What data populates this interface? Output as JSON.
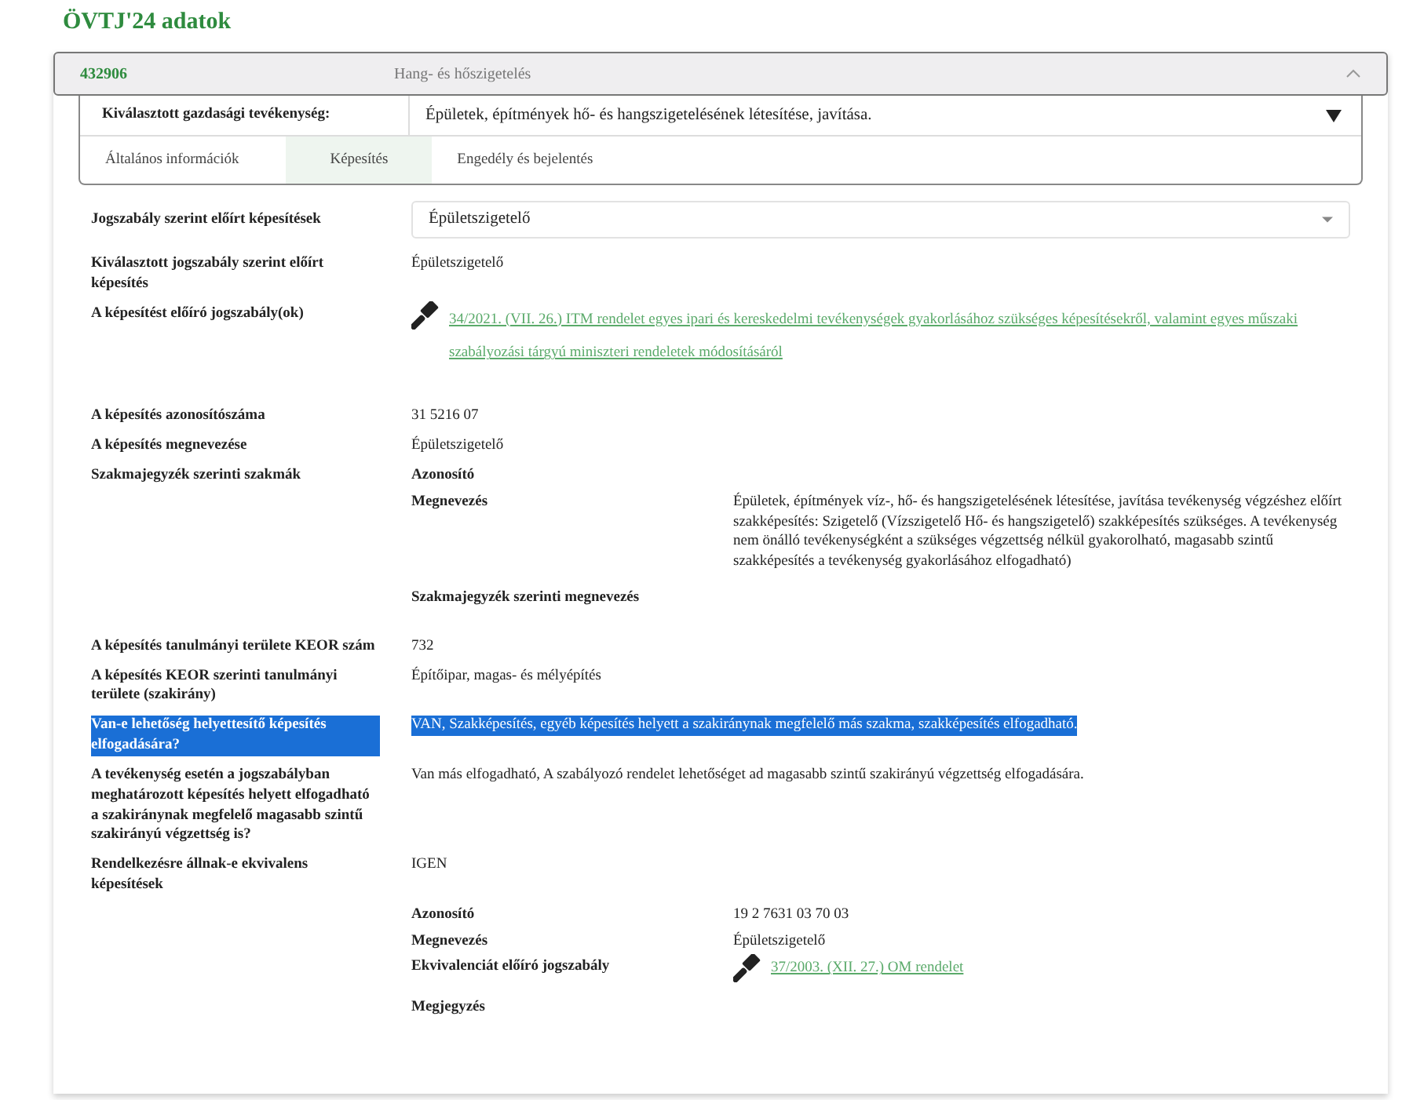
{
  "title": "ÖVTJ'24 adatok",
  "panel": {
    "code": "432906",
    "name": "Hang- és hőszigetelés",
    "expanded": true
  },
  "activity": {
    "label": "Kiválasztott gazdasági tevékenység:",
    "value": "Épületek, építmények hő- és hangszigetelésének létesítése, javítása."
  },
  "tabs": [
    {
      "label": "Általános információk",
      "selected": false
    },
    {
      "label": "Képesítés",
      "selected": true
    },
    {
      "label": "Engedély és bejelentés",
      "selected": false
    }
  ],
  "fields": [
    {
      "kind": "select",
      "label": "Jogszabály szerint előírt képesítések",
      "value": "Épületszigetelő"
    },
    {
      "kind": "text",
      "label": "Kiválasztott jogszabály szerint előírt képesítés",
      "value": "Épületszigetelő"
    },
    {
      "kind": "link",
      "label": "A képesítést előíró jogszabály(ok)",
      "value": "34/2021. (VII. 26.) ITM rendelet egyes ipari és kereskedelmi tevékenységek gyakorlásához szükséges képesítésekről, valamint egyes műszaki szabályozási tárgyú miniszteri rendeletek módosításáról"
    },
    {
      "kind": "text",
      "label": "A képesítés azonosítószáma",
      "value": "31 5216 07"
    },
    {
      "kind": "text",
      "label": "A képesítés megnevezése",
      "value": "Épületszigetelő"
    },
    {
      "kind": "group",
      "label": "Szakmajegyzék szerinti szakmák",
      "items": [
        {
          "label": "Azonosító"
        },
        {
          "label": "Megnevezés",
          "value": "Épületek, építmények víz-, hő- és hangszigetelésének létesítése, javítása tevékenység végzéshez előírt szakképesítés: Szigetelő (Vízszigetelő Hő- és hangszigetelő) szakképesítés szükséges. A tevékenység nem önálló tevékenységként a szükséges végzettség nélkül gyakorolható, magasabb szintű szakképesítés a tevékenység gyakorlásához elfogadható)"
        },
        {
          "label": "Szakmajegyzék szerinti megnevezés"
        }
      ]
    },
    {
      "kind": "text",
      "label": "A képesítés tanulmányi területe KEOR szám",
      "value": "732"
    },
    {
      "kind": "text",
      "label": "A képesítés KEOR szerinti tanulmányi területe (szakirány)",
      "value": "Építőipar, magas- és mélyépítés"
    },
    {
      "kind": "text",
      "label": "Van-e lehetőség helyettesítő képesítés elfogadására?",
      "value": "VAN, Szakképesítés, egyéb képesítés helyett a szakiránynak megfelelő más szakma, szakképesítés elfogadható.",
      "highlighted": true
    },
    {
      "kind": "text",
      "label": "A tevékenység esetén a jogszabályban meghatározott képesítés helyett elfogadható a szakiránynak megfelelő magasabb szintű szakirányú végzettség is?",
      "value": "Van más elfogadható, A szabályozó rendelet lehetőséget ad magasabb szintű szakirányú végzettség elfogadására."
    },
    {
      "kind": "text",
      "label": "Rendelkezésre állnak-e ekvivalens képesítések",
      "value": "IGEN"
    },
    {
      "kind": "group",
      "items": [
        {
          "label": "Azonosító",
          "value": "19 2 7631 03 70 03"
        },
        {
          "label": "Megnevezés",
          "value": "Épületszigetelő"
        },
        {
          "label": "Ekvivalenciát előíró jogszabály",
          "link": "37/2003. (XII. 27.) OM rendelet"
        },
        {
          "label": "Megjegyzés"
        }
      ]
    }
  ]
}
